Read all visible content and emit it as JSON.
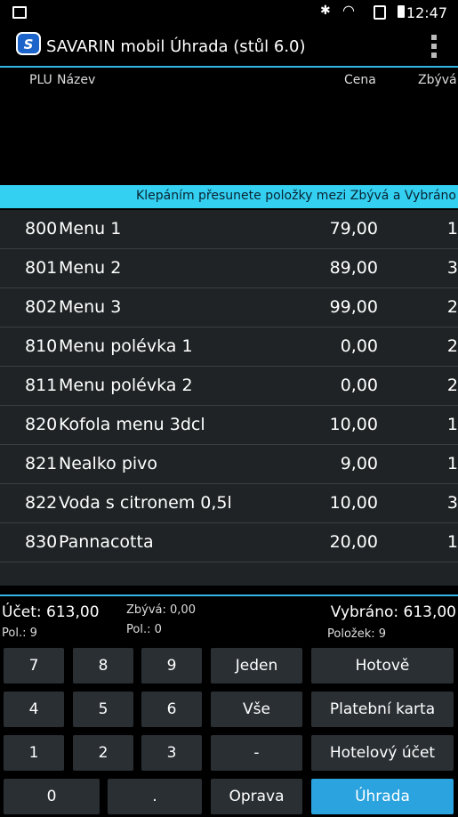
{
  "status": {
    "time": "12:47"
  },
  "app": {
    "title": "SAVARIN mobil Úhrada (stůl 6.0)"
  },
  "header": {
    "plu": "PLU",
    "name": "Název",
    "price": "Cena",
    "remaining": "Zbývá"
  },
  "hint": "Klepáním přesunete položky mezi Zbývá a Vybráno",
  "items": [
    {
      "plu": "800",
      "name": "Menu 1",
      "price": "79,00",
      "remaining": "1"
    },
    {
      "plu": "801",
      "name": "Menu 2",
      "price": "89,00",
      "remaining": "3"
    },
    {
      "plu": "802",
      "name": "Menu 3",
      "price": "99,00",
      "remaining": "2"
    },
    {
      "plu": "810",
      "name": "Menu polévka 1",
      "price": "0,00",
      "remaining": "2"
    },
    {
      "plu": "811",
      "name": "Menu polévka 2",
      "price": "0,00",
      "remaining": "2"
    },
    {
      "plu": "820",
      "name": "Kofola menu 3dcl",
      "price": "10,00",
      "remaining": "1"
    },
    {
      "plu": "821",
      "name": "Nealko pivo",
      "price": "9,00",
      "remaining": "1"
    },
    {
      "plu": "822",
      "name": "Voda s citronem 0,5l",
      "price": "10,00",
      "remaining": "3"
    },
    {
      "plu": "830",
      "name": "Pannacotta",
      "price": "20,00",
      "remaining": "1"
    }
  ],
  "summary": {
    "account": "Účet: 613,00",
    "account_items": "Pol.:   9",
    "remaining": "Zbývá: 0,00",
    "remaining_items": "Pol.:   0",
    "selected": "Vybráno: 613,00",
    "selected_items": "Položek:   9"
  },
  "keys": {
    "k7": "7",
    "k8": "8",
    "k9": "9",
    "k4": "4",
    "k5": "5",
    "k6": "6",
    "k1": "1",
    "k2": "2",
    "k3": "3",
    "k0": "0",
    "dot": ".",
    "minus": "-",
    "one": "Jeden",
    "all": "Vše",
    "fix": "Oprava",
    "cash": "Hotově",
    "card": "Platební karta",
    "hotel": "Hotelový účet",
    "pay": "Úhrada"
  },
  "colors": {
    "accent": "#33b5e5",
    "hint_bg": "#33d0f2",
    "pay_button": "#2aa3de"
  }
}
